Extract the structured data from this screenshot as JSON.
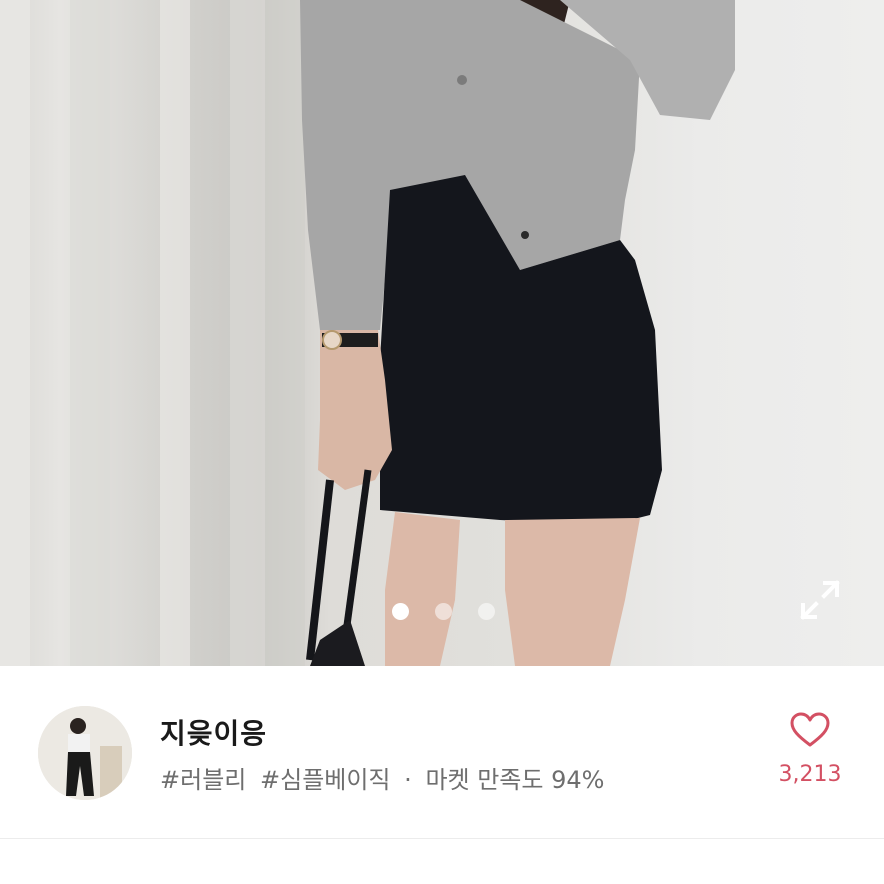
{
  "carousel": {
    "image_alt": "",
    "page_count": 3,
    "active_index": 0
  },
  "seller": {
    "name": "지읒이응",
    "tags": [
      "#러블리",
      "#심플베이직"
    ],
    "separator": "·",
    "satisfaction_label": "마켓 만족도 94%"
  },
  "like": {
    "count": "3,213",
    "color": "#d35063"
  },
  "icons": {
    "expand": "expand-icon",
    "heart": "heart-outline-icon"
  }
}
